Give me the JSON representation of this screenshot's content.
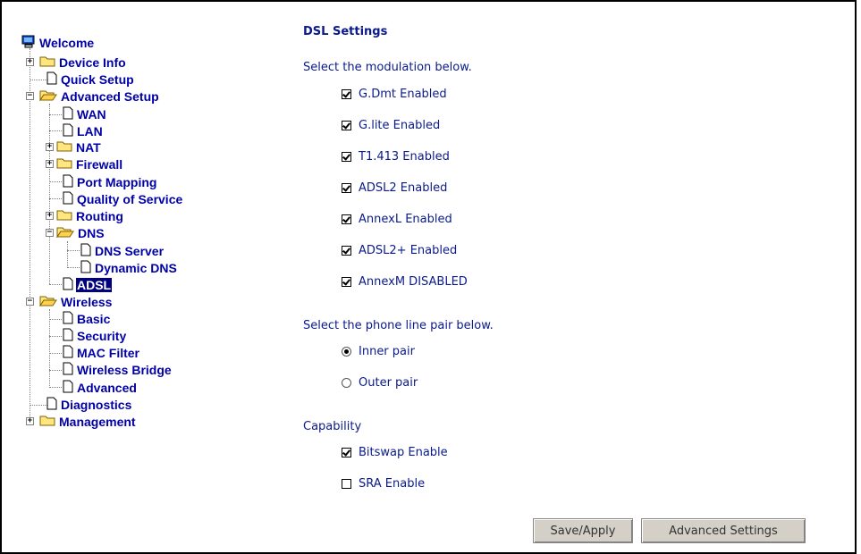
{
  "tree": {
    "welcome": "Welcome",
    "device_info": "Device Info",
    "quick_setup": "Quick Setup",
    "advanced_setup": "Advanced Setup",
    "wan": "WAN",
    "lan": "LAN",
    "nat": "NAT",
    "firewall": "Firewall",
    "port_mapping": "Port Mapping",
    "qos": "Quality of Service",
    "routing": "Routing",
    "dns": "DNS",
    "dns_server": "DNS Server",
    "dynamic_dns": "Dynamic DNS",
    "adsl": "ADSL",
    "wireless": "Wireless",
    "basic": "Basic",
    "security": "Security",
    "mac_filter": "MAC Filter",
    "wireless_bridge": "Wireless Bridge",
    "advanced": "Advanced",
    "diagnostics": "Diagnostics",
    "management": "Management",
    "selected": "ADSL"
  },
  "main": {
    "title": "DSL Settings",
    "modulation_prompt": "Select the modulation below.",
    "modulations": [
      {
        "label": "G.Dmt Enabled",
        "checked": true
      },
      {
        "label": "G.lite Enabled",
        "checked": true
      },
      {
        "label": "T1.413 Enabled",
        "checked": true
      },
      {
        "label": "ADSL2 Enabled",
        "checked": true
      },
      {
        "label": "AnnexL Enabled",
        "checked": true
      },
      {
        "label": "ADSL2+ Enabled",
        "checked": true
      },
      {
        "label": "AnnexM DISABLED",
        "checked": true
      }
    ],
    "phone_prompt": "Select the phone line pair below.",
    "pairs": [
      {
        "label": "Inner pair",
        "selected": true
      },
      {
        "label": "Outer pair",
        "selected": false
      }
    ],
    "capability_label": "Capability",
    "capabilities": [
      {
        "label": "Bitswap Enable",
        "checked": true
      },
      {
        "label": "SRA Enable",
        "checked": false
      }
    ],
    "save_apply": "Save/Apply",
    "advanced_settings": "Advanced Settings"
  }
}
